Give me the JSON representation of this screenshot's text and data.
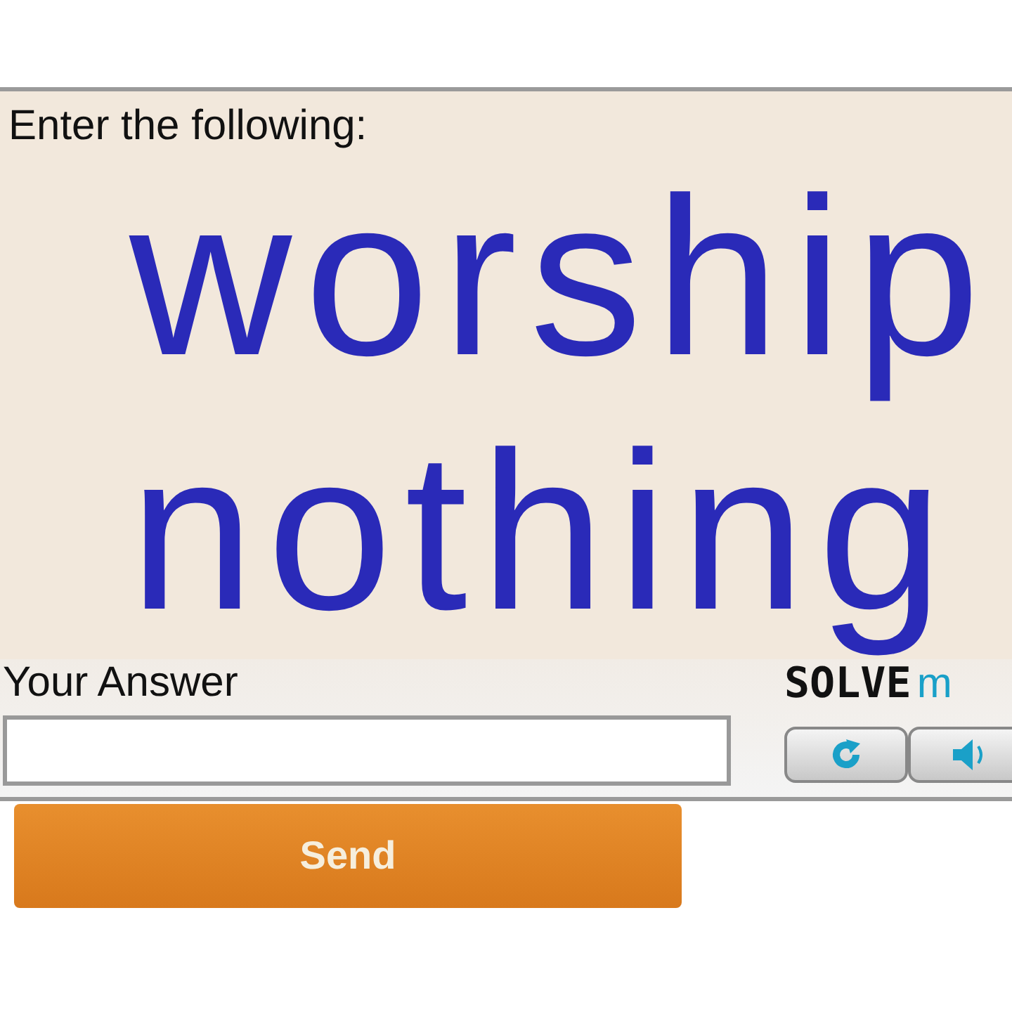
{
  "prompt": "Enter the following:",
  "captcha": {
    "lines": [
      "worship",
      "nothing"
    ]
  },
  "answer": {
    "label": "Your Answer"
  },
  "logo": {
    "text": "SOLVE",
    "accent": "m"
  },
  "send_button": "Send"
}
